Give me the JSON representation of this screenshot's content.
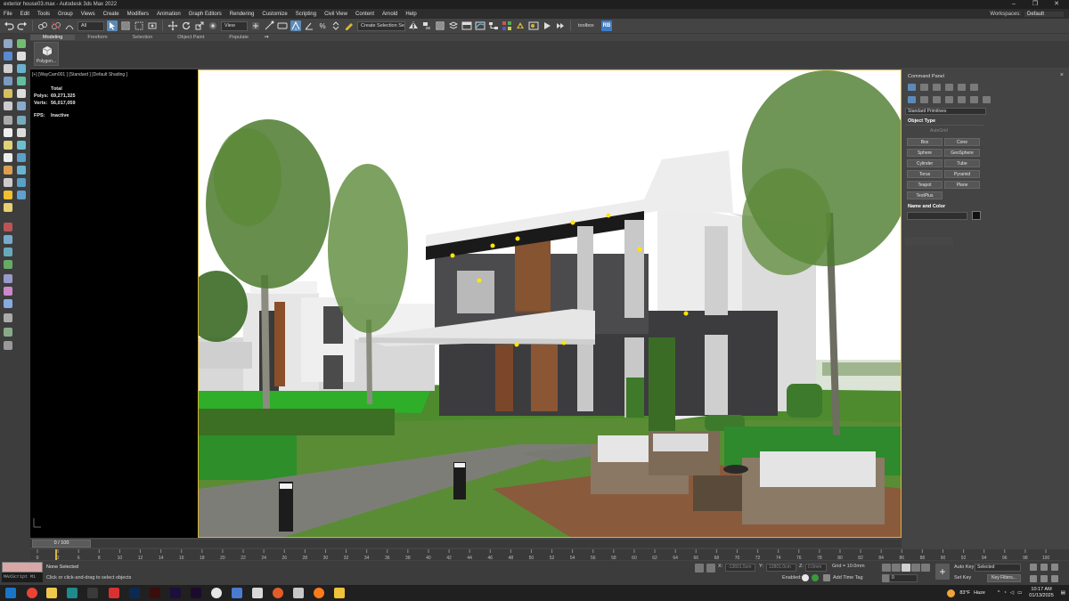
{
  "window": {
    "title": "exterior house03.max - Autodesk 3ds Max 2022",
    "controls": [
      "–",
      "❐",
      "✕"
    ]
  },
  "menubar": {
    "items": [
      "File",
      "Edit",
      "Tools",
      "Group",
      "Views",
      "Create",
      "Modifiers",
      "Animation",
      "Graph Editors",
      "Rendering",
      "Customize",
      "Scripting",
      "Civil View",
      "Content",
      "Arnold",
      "Help"
    ],
    "workspaces_label": "Workspaces:",
    "workspaces_value": "Default"
  },
  "toolbar": {
    "filter_value": "All",
    "refcoord_value": "View",
    "selection_set_placeholder": "Create Selection Se",
    "toolbox_label": "toolbox",
    "rb_label": "RB"
  },
  "ribbon": {
    "tabs": [
      "Modeling",
      "Freeform",
      "Selection",
      "Object Paint",
      "Populate"
    ],
    "active_tab": "Modeling",
    "polygon_button": "Polygon..."
  },
  "viewport": {
    "label": "[+] [WayCam001 ] [Standard ] [Default Shading ]",
    "stats_total_label": "Total",
    "polys_label": "Polys:",
    "polys_value": "69,271,325",
    "verts_label": "Verts:",
    "verts_value": "56,017,059",
    "fps_label": "FPS:",
    "fps_value": "Inactive"
  },
  "command_panel": {
    "title": "Command Panel",
    "category_dropdown": "Standard Primitives",
    "object_type_title": "Object Type",
    "autogrid_label": "AutoGrid",
    "object_buttons": [
      "Box",
      "Cone",
      "Sphere",
      "GeoSphere",
      "Cylinder",
      "Tube",
      "Torus",
      "Pyramid",
      "Teapot",
      "Plane",
      "TextPlus"
    ],
    "name_color_title": "Name and Color",
    "color": "#111111"
  },
  "timeline": {
    "frame_display": "0 / 100",
    "ticks": [
      "0",
      "5",
      "10",
      "15",
      "20",
      "25",
      "30",
      "35",
      "40",
      "45",
      "50",
      "55",
      "60",
      "65",
      "70",
      "75",
      "80",
      "85",
      "90",
      "95",
      "100"
    ],
    "tick_numbers": [
      "0",
      "2",
      "6",
      "8",
      "10",
      "12",
      "14",
      "16",
      "18",
      "20",
      "22",
      "24",
      "26",
      "28",
      "30",
      "32",
      "34",
      "36",
      "38",
      "40",
      "42",
      "44",
      "46",
      "48",
      "50",
      "52",
      "54",
      "56",
      "58",
      "60",
      "62",
      "64",
      "66",
      "68",
      "70",
      "72",
      "74",
      "76",
      "78",
      "80",
      "82",
      "84",
      "86",
      "88",
      "90",
      "92",
      "94",
      "96",
      "98",
      "100"
    ]
  },
  "status": {
    "maxscript_label": "MAXScript Mi",
    "selection": "None Selected",
    "prompt": "Click or click-and-drag to select objects",
    "x_label": "X:",
    "x_value": "-13601.5cm",
    "y_label": "Y:",
    "y_value": "12801.0cm",
    "z_label": "Z:",
    "z_value": "0.0mm",
    "grid_label": "Grid = 10.0mm",
    "enabled_label": "Enabled:",
    "add_time_tag": "Add Time Tag",
    "autokey_label": "Auto Key",
    "setkey_label": "Set Key",
    "selected_value": "Selected",
    "key_filters": "Key Filters...",
    "frame_value": "0"
  },
  "taskbar": {
    "weather_temp": "83°F",
    "weather_text": "Haze",
    "time": "10:17 AM",
    "date": "01/13/2025"
  },
  "colors": {
    "accent": "#d7b33a",
    "panel": "#444444",
    "viewport_bg": "#000000"
  }
}
